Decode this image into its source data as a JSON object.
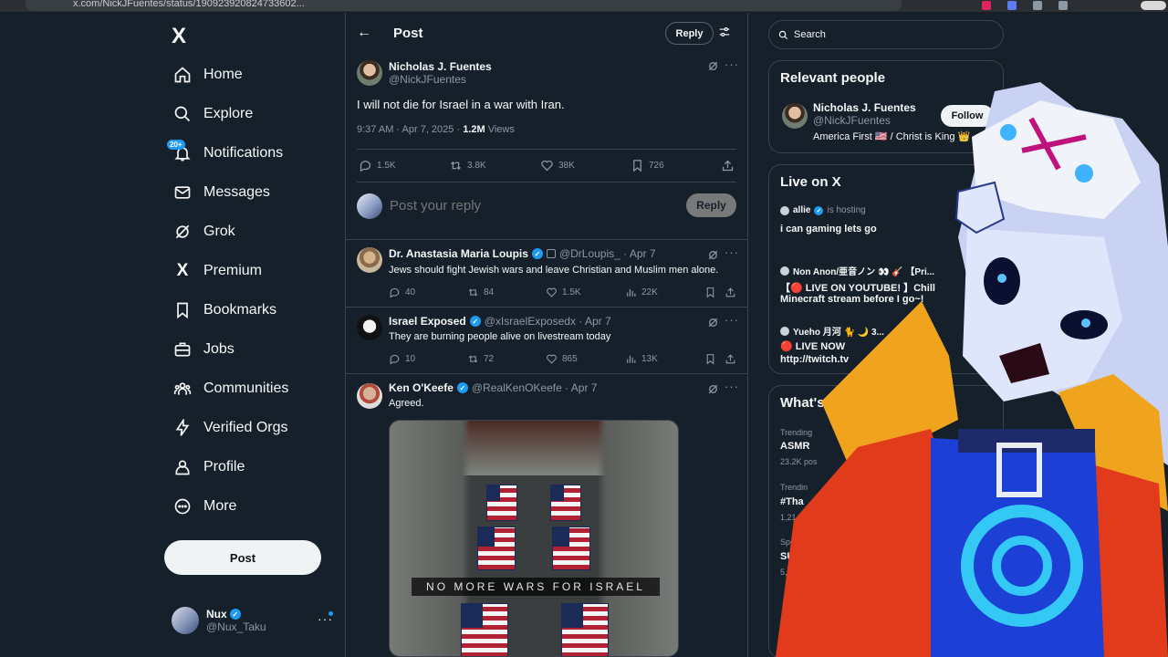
{
  "browser": {
    "url": "x.com/NickJFuentes/status/190923920824733602..."
  },
  "nav": {
    "logo": "X",
    "items": [
      {
        "label": "Home",
        "icon": "home-icon"
      },
      {
        "label": "Explore",
        "icon": "search-icon"
      },
      {
        "label": "Notifications",
        "icon": "bell-icon",
        "badge": "20+"
      },
      {
        "label": "Messages",
        "icon": "envelope-icon"
      },
      {
        "label": "Grok",
        "icon": "grok-icon"
      },
      {
        "label": "Premium",
        "icon": "x-premium-icon"
      },
      {
        "label": "Bookmarks",
        "icon": "bookmark-icon"
      },
      {
        "label": "Jobs",
        "icon": "briefcase-icon"
      },
      {
        "label": "Communities",
        "icon": "people-icon"
      },
      {
        "label": "Verified Orgs",
        "icon": "lightning-icon"
      },
      {
        "label": "Profile",
        "icon": "person-icon"
      },
      {
        "label": "More",
        "icon": "more-circle-icon"
      }
    ],
    "post_button": "Post",
    "me": {
      "name": "Nux",
      "handle": "@Nux_Taku"
    }
  },
  "header": {
    "title": "Post",
    "reply_button": "Reply"
  },
  "main_post": {
    "name": "Nicholas J. Fuentes",
    "handle": "@NickJFuentes",
    "text": "I will not die for Israel in a war with Iran.",
    "time": "9:37 AM · Apr 7, 2025 · ",
    "views_count": "1.2M",
    "views_label": " Views",
    "replies": "1.5K",
    "reposts": "3.8K",
    "likes": "38K",
    "bookmarks": "726"
  },
  "reply_box": {
    "placeholder": "Post your reply",
    "button": "Reply"
  },
  "replies": [
    {
      "name": "Dr. Anastasia Maria Loupis",
      "handle": "@DrLoupis_ · Apr 7",
      "text": "Jews should fight Jewish wars and leave Christian and Muslim men alone.",
      "replies": "40",
      "reposts": "84",
      "likes": "1.5K",
      "views": "22K"
    },
    {
      "name": "Israel Exposed",
      "handle": "@xIsraelExposedx · Apr 7",
      "text": "They are burning people alive on livestream today",
      "replies": "10",
      "reposts": "72",
      "likes": "865",
      "views": "13K"
    },
    {
      "name": "Ken O'Keefe",
      "handle": "@RealKenOKeefe · Apr 7",
      "text": "Agreed.",
      "media_caption": "NO MORE WARS FOR ISRAEL"
    }
  ],
  "sidebar": {
    "search_placeholder": "Search",
    "relevant": {
      "title": "Relevant people",
      "name": "Nicholas J. Fuentes",
      "handle": "@NickJFuentes",
      "bio": "America First 🇺🇸 / Christ is King 👑",
      "follow": "Follow"
    },
    "live": {
      "title": "Live on X",
      "items": [
        {
          "host": "allie",
          "status": "is hosting",
          "title": "i can gaming lets go"
        },
        {
          "host": "Non Anon/亜音ノン 👀 🎸 【Pri...",
          "title_line1": "【🔴 LIVE ON YOUTUBE! 】Chill",
          "title_line2": "Minecraft stream before I go~!"
        },
        {
          "host": "Yueho 月河 🐈 🌙 3...",
          "title_line1": "🔴 LIVE NOW",
          "title_line2": "http://twitch.tv"
        }
      ]
    },
    "trends": {
      "title": "What's",
      "items": [
        {
          "meta": "Trending",
          "name": "ASMR",
          "count": "23.2K pos"
        },
        {
          "meta": "Trendin",
          "name": "#Tha",
          "count": "1,214"
        },
        {
          "meta": "Spo",
          "name": "SU",
          "count": "5,8"
        }
      ]
    }
  }
}
